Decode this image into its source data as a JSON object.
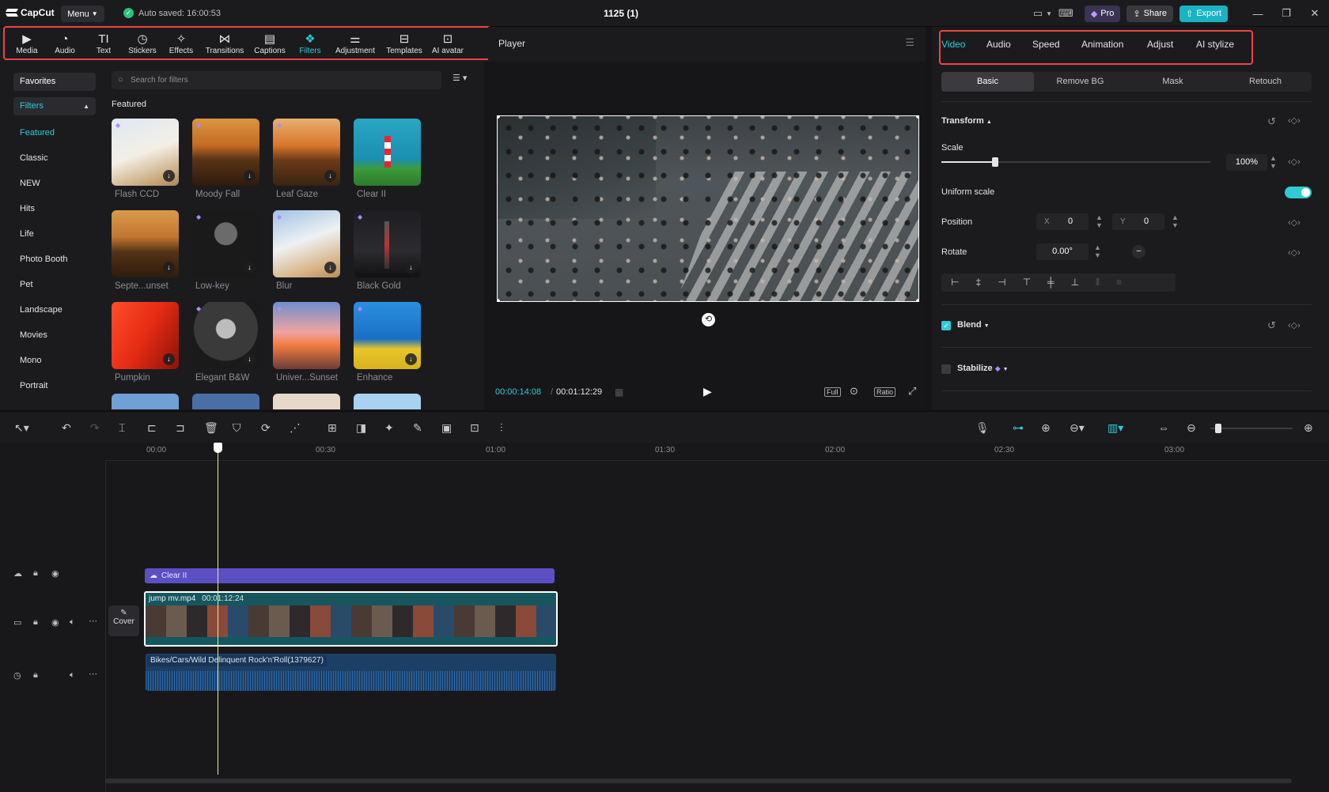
{
  "titlebar": {
    "app_name": "CapCut",
    "menu_label": "Menu",
    "autosave_text": "Auto saved: 16:00:53",
    "project_title": "1125 (1)",
    "pro_label": "Pro",
    "share_label": "Share",
    "export_label": "Export"
  },
  "toolbar": {
    "tools": [
      {
        "label": "Media",
        "icon": "media-icon"
      },
      {
        "label": "Audio",
        "icon": "audio-icon"
      },
      {
        "label": "Text",
        "icon": "text-icon"
      },
      {
        "label": "Stickers",
        "icon": "sticker-icon"
      },
      {
        "label": "Effects",
        "icon": "effects-icon"
      },
      {
        "label": "Transitions",
        "icon": "transitions-icon"
      },
      {
        "label": "Captions",
        "icon": "captions-icon"
      },
      {
        "label": "Filters",
        "icon": "filters-icon"
      },
      {
        "label": "Adjustment",
        "icon": "adjustment-icon"
      },
      {
        "label": "Templates",
        "icon": "templates-icon"
      },
      {
        "label": "AI avatar",
        "icon": "ai-avatar-icon"
      }
    ],
    "active": "Filters"
  },
  "filters_panel": {
    "favorites_label": "Favorites",
    "filters_label": "Filters",
    "categories": [
      "Featured",
      "Classic",
      "NEW",
      "Hits",
      "Life",
      "Photo Booth",
      "Pet",
      "Landscape",
      "Movies",
      "Mono",
      "Portrait"
    ],
    "search_placeholder": "Search for filters",
    "section_title": "Featured",
    "items": [
      "Flash CCD",
      "Moody Fall",
      "Leaf Gaze",
      "Clear II",
      "Septe...unset",
      "Low-key",
      "Blur",
      "Black Gold",
      "Pumpkin",
      "Elegant B&W",
      "Univer...Sunset",
      "Enhance"
    ]
  },
  "player": {
    "title": "Player",
    "current_time": "00:00:14:08",
    "total_time": "00:01:12:29",
    "full_label": "Full",
    "ratio_label": "Ratio"
  },
  "properties": {
    "tabs": [
      "Video",
      "Audio",
      "Speed",
      "Animation",
      "Adjust",
      "AI stylize"
    ],
    "active_tab": "Video",
    "subtabs": [
      "Basic",
      "Remove BG",
      "Mask",
      "Retouch"
    ],
    "active_subtab": "Basic",
    "transform_label": "Transform",
    "scale_label": "Scale",
    "scale_value": "100%",
    "scale_fraction": 0.2,
    "uniform_scale_label": "Uniform scale",
    "uniform_scale_on": true,
    "position_label": "Position",
    "x_label": "X",
    "x_value": "0",
    "y_label": "Y",
    "y_value": "0",
    "rotate_label": "Rotate",
    "rotate_value": "0.00°",
    "blend_label": "Blend",
    "stabilize_label": "Stabilize"
  },
  "timeline": {
    "ruler": [
      "00:00",
      "00:30",
      "01:00",
      "01:30",
      "02:00",
      "02:30",
      "03:00"
    ],
    "filter_clip_label": "Clear II",
    "video_clip_name": "jump mv.mp4",
    "video_clip_duration": "00:01:12:24",
    "cover_label": "Cover",
    "audio_clip_name": "Bikes/Cars/Wild Delinquent Rock'n'Roll(1379627)"
  },
  "colors": {
    "accent": "#2fcbd6",
    "highlight_box": "#f04343",
    "filter_track": "#5b4fc4",
    "video_track": "#1e6b75",
    "audio_track": "#1c3f66"
  }
}
